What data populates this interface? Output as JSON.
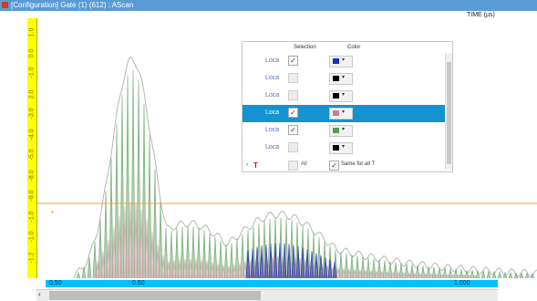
{
  "window": {
    "title": "[Configuration] Gate (1) (612) : AScan"
  },
  "axis": {
    "time_label": "TIME (µs)",
    "y_ticks": [
      "1.0",
      "0.0",
      "-1.0",
      "2.0",
      "-3.0",
      "-4.0",
      "-5.0",
      "-8.0",
      "-9.0",
      "-1.0",
      "-1.0",
      "-1.2"
    ],
    "x_ticks": [
      "0.50",
      "0.60",
      "1.000"
    ]
  },
  "legend": {
    "header_selection": "Selection",
    "header_color": "Color",
    "rows": [
      {
        "name": "Loca",
        "checked": true,
        "color": "#1b2fbf",
        "selected": false
      },
      {
        "name": "Loca",
        "checked": false,
        "color": "#000000",
        "selected": false
      },
      {
        "name": "Loca",
        "checked": false,
        "color": "#000000",
        "selected": false
      },
      {
        "name": "Loca",
        "checked": true,
        "color": "#c77d9b",
        "selected": true
      },
      {
        "name": "Loca",
        "checked": true,
        "color": "#5a9a5a",
        "selected": false
      },
      {
        "name": "Loca",
        "checked": false,
        "color": "#000000",
        "selected": false
      }
    ],
    "footer": {
      "all_label": "All",
      "same_label": "Same for all T",
      "same_checked": true
    }
  },
  "colors": {
    "gray_envelope": "#b5b5b5",
    "green_series": "#6fa86f",
    "pink_series": "#d49aa8",
    "blue_series": "#2233aa",
    "gate_line": "#f0a830"
  }
}
